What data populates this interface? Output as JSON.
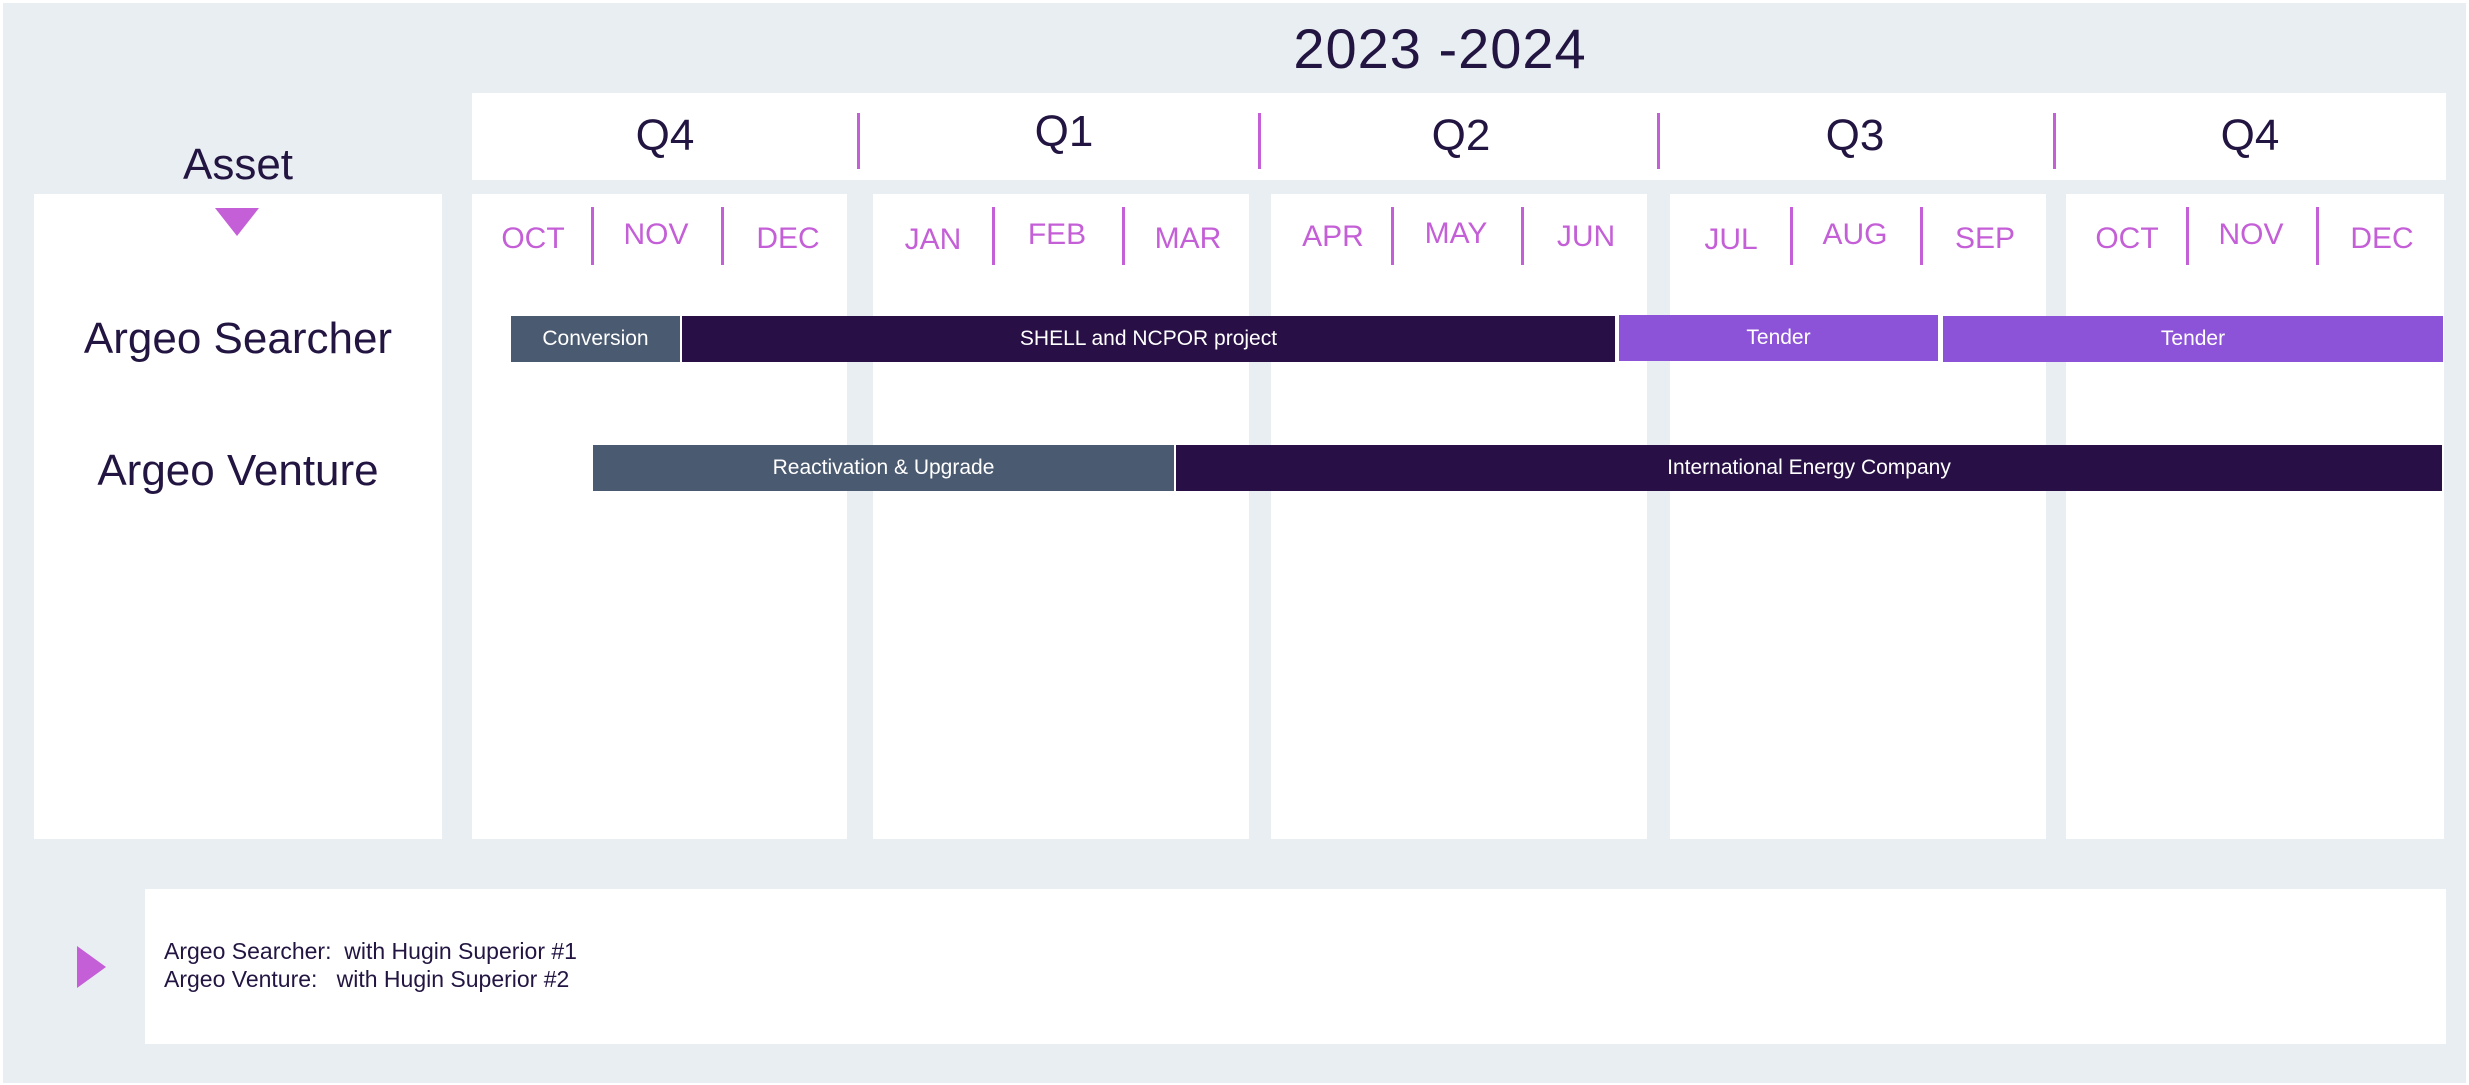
{
  "title": "2023 -2024",
  "asset_heading": "Asset",
  "quarters": [
    "Q4",
    "Q1",
    "Q2",
    "Q3",
    "Q4"
  ],
  "months": [
    "OCT",
    "NOV",
    "DEC",
    "JAN",
    "FEB",
    "MAR",
    "APR",
    "MAY",
    "JUN",
    "JUL",
    "AUG",
    "SEP",
    "OCT",
    "NOV",
    "DEC"
  ],
  "assets": [
    {
      "name": "Argeo Searcher",
      "activities": [
        {
          "label": "Conversion",
          "color": "#4a5a70"
        },
        {
          "label": "SHELL and NCPOR project",
          "color": "#281046"
        },
        {
          "label": "Tender",
          "color": "#8c52d7"
        },
        {
          "label": "Tender",
          "color": "#8c52d7"
        }
      ]
    },
    {
      "name": "Argeo Venture",
      "activities": [
        {
          "label": "Reactivation & Upgrade",
          "color": "#4a5a70"
        },
        {
          "label": "International Energy Company",
          "color": "#281046"
        }
      ]
    }
  ],
  "notes": [
    {
      "asset": "Argeo Searcher:",
      "detail": "with Hugin Superior #1"
    },
    {
      "asset": "Argeo Venture:",
      "detail": "with Hugin Superior #2"
    }
  ],
  "colors": {
    "accent": "#c45fd7",
    "navy": "#231541",
    "slate": "#4a5a70",
    "dark_purple": "#281046",
    "violet": "#8c52d7",
    "background": "#e9eef2"
  }
}
